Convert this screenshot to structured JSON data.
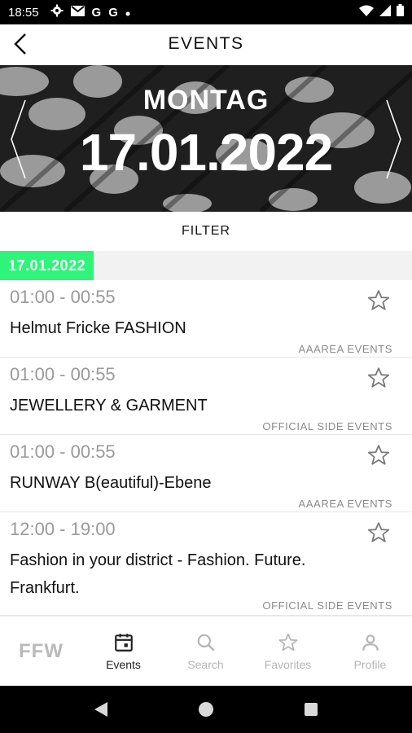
{
  "status_bar": {
    "time": "18:55",
    "notifications": [
      "settings-icon",
      "gmail-icon",
      "g-icon",
      "g-icon",
      "dot-icon"
    ],
    "g1": "G",
    "g2": "G"
  },
  "header": {
    "title": "EVENTS"
  },
  "banner": {
    "day": "MONTAG",
    "date": "17.01.2022"
  },
  "filter": {
    "label": "FILTER"
  },
  "section": {
    "date_chip": "17.01.2022",
    "accent_color": "#2ef57a"
  },
  "events": [
    {
      "time": "01:00 - 00:55",
      "title": "Helmut Fricke FASHION",
      "category": "AAAREA EVENTS"
    },
    {
      "time": "01:00 - 00:55",
      "title": "JEWELLERY & GARMENT",
      "category": "OFFICIAL SIDE EVENTS"
    },
    {
      "time": "01:00 - 00:55",
      "title": "RUNWAY B(eautiful)-Ebene",
      "category": "AAAREA EVENTS"
    },
    {
      "time": "12:00 - 19:00",
      "title": "Fashion in your district - Fashion. Future. Frankfurt.",
      "category": "OFFICIAL SIDE EVENTS"
    }
  ],
  "bottom_nav": {
    "logo": "FFW",
    "items": [
      {
        "label": "Events",
        "icon": "calendar-icon",
        "active": true
      },
      {
        "label": "Search",
        "icon": "search-icon",
        "active": false
      },
      {
        "label": "Favorites",
        "icon": "star-icon",
        "active": false
      },
      {
        "label": "Profile",
        "icon": "profile-icon",
        "active": false
      }
    ]
  }
}
